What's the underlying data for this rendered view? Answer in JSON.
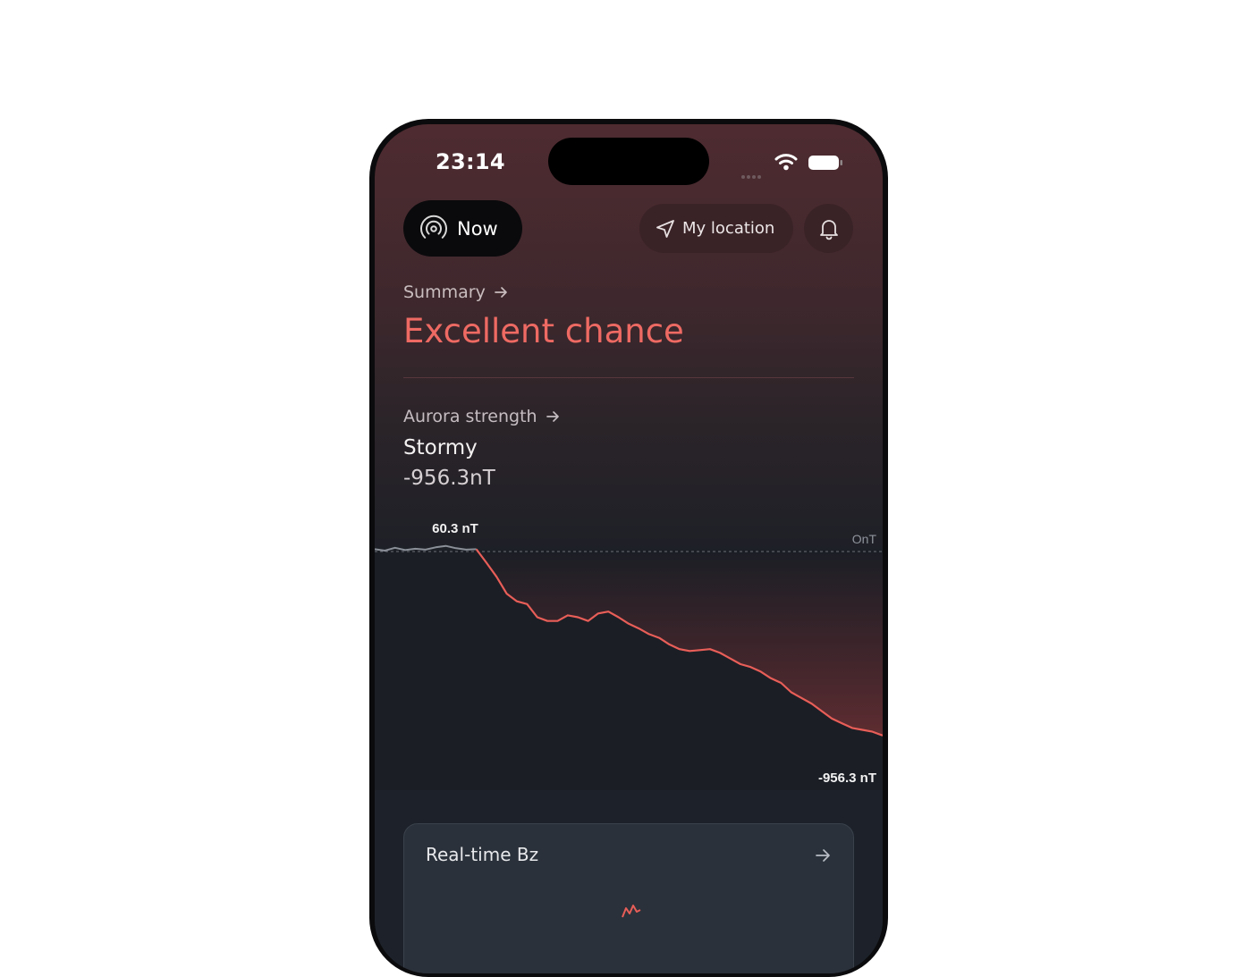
{
  "status_bar": {
    "time": "23:14",
    "wifi_icon": "wifi-icon",
    "battery_icon": "battery-icon"
  },
  "toolbar": {
    "now_label": "Now",
    "now_icon": "broadcast-icon",
    "location_label": "My location",
    "location_icon": "location-arrow-icon",
    "bell_icon": "bell-icon"
  },
  "summary": {
    "label": "Summary",
    "value": "Excellent chance"
  },
  "aurora": {
    "label": "Aurora strength",
    "level": "Stormy",
    "value": "-956.3nT"
  },
  "chart_data": {
    "type": "line",
    "start_label": "60.3 nT",
    "zero_label": "OnT",
    "end_label": "-956.3 nT",
    "y_reference": 0,
    "x": [
      0,
      1,
      2,
      3,
      4,
      5,
      6,
      7,
      8,
      9,
      10,
      11,
      12,
      13,
      14,
      15,
      16,
      17,
      18,
      19,
      20,
      21,
      22,
      23,
      24,
      25,
      26,
      27,
      28,
      29,
      30,
      31,
      32,
      33,
      34,
      35,
      36,
      37,
      38,
      39,
      40,
      41,
      42,
      43,
      44,
      45,
      46,
      47,
      48,
      49,
      50
    ],
    "values": [
      25,
      10,
      40,
      15,
      30,
      20,
      45,
      60.3,
      35,
      20,
      25,
      -120,
      -270,
      -450,
      -530,
      -560,
      -700,
      -740,
      -740,
      -680,
      -700,
      -740,
      -660,
      -640,
      -700,
      -770,
      -820,
      -880,
      -920,
      -990,
      -1040,
      -1060,
      -1050,
      -1040,
      -1080,
      -1140,
      -1200,
      -1230,
      -1280,
      -1350,
      -1400,
      -1500,
      -1560,
      -1620,
      -1700,
      -1780,
      -1830,
      -1880,
      -1900,
      -1920,
      -1960
    ],
    "colors": {
      "above_zero": "#8a8f98",
      "below_zero": "#e85e58",
      "reference": "#6d7078"
    }
  },
  "card": {
    "title": "Real-time Bz"
  },
  "colors": {
    "accent": "#ee6a63",
    "background_top": "#4e2b30",
    "background_bottom": "#1b1e25"
  }
}
